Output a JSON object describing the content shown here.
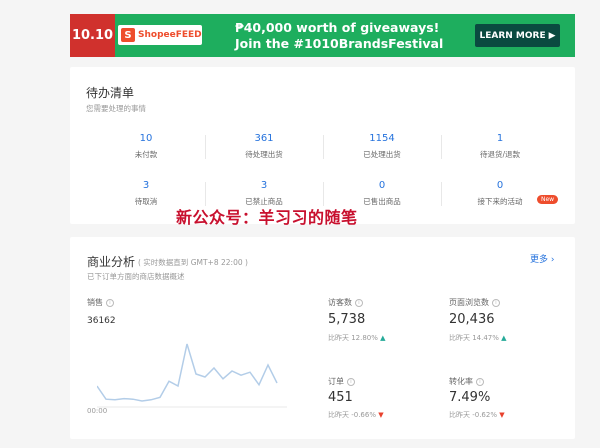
{
  "banner": {
    "date": "10.10",
    "feed_icon": "S",
    "feed_label": "ShopeeFEED",
    "line1": "₱40,000 worth of giveaways!",
    "line2": "Join the #1010BrandsFestival",
    "button": "LEARN MORE",
    "button_arrow": "▶"
  },
  "todo": {
    "title": "待办清单",
    "subtitle": "您需要处理的事情",
    "items": [
      {
        "value": "10",
        "label": "未付款"
      },
      {
        "value": "361",
        "label": "待处理出货"
      },
      {
        "value": "1154",
        "label": "已处理出货"
      },
      {
        "value": "1",
        "label": "待退货/退款"
      },
      {
        "value": "3",
        "label": "待取消"
      },
      {
        "value": "3",
        "label": "已禁止商品"
      },
      {
        "value": "0",
        "label": "已售出商品"
      },
      {
        "value": "0",
        "label": "接下来的活动"
      }
    ],
    "new_badge": "New"
  },
  "watermark": "新公众号：羊习习的随笔",
  "business": {
    "title": "商业分析",
    "realtime": "( 实时数据直到 GMT+8 22:00 )",
    "subtitle": "已下订单方面的商店数据概述",
    "more": "更多",
    "more_arrow": "›",
    "sales_label": "销售",
    "sales_value": "36162",
    "axis_start": "00:00",
    "info_glyph": "i",
    "metrics": [
      {
        "label": "访客数",
        "value": "5,738",
        "compare": "比昨天 12.80%",
        "arrow": "▲",
        "dir": "up"
      },
      {
        "label": "页面浏览数",
        "value": "20,436",
        "compare": "比昨天 14.47%",
        "arrow": "▲",
        "dir": "up"
      },
      {
        "label": "订单",
        "value": "451",
        "compare": "比昨天 -0.66%",
        "arrow": "▼",
        "dir": "down"
      },
      {
        "label": "转化率",
        "value": "7.49%",
        "compare": "比昨天 -0.62%",
        "arrow": "▼",
        "dir": "down"
      }
    ],
    "chart_series": [
      30,
      8,
      7,
      9,
      8,
      5,
      7,
      11,
      38,
      30,
      100,
      50,
      45,
      60,
      42,
      55,
      48,
      53,
      32,
      65,
      35
    ],
    "colors": {
      "line": "#b3cde8",
      "up": "#26aa99",
      "down": "#e8412d",
      "link": "#2673dd"
    }
  }
}
